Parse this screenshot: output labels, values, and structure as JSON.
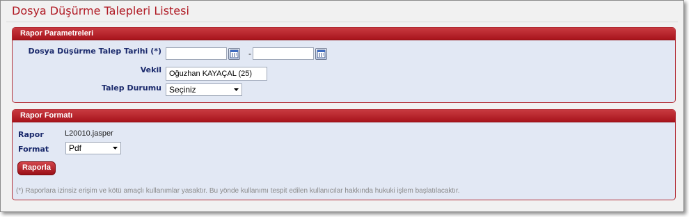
{
  "page": {
    "title": "Dosya Düşürme Talepleri Listesi"
  },
  "params_panel": {
    "header": "Rapor Parametreleri",
    "date_label": "Dosya Düşürme Talep Tarihi (*)",
    "date_from": "",
    "date_separator": "-",
    "date_to": "",
    "vekil_label": "Vekil",
    "vekil_value": "Oğuzhan KAYAÇAL (25)",
    "status_label": "Talep Durumu",
    "status_value": "Seçiniz"
  },
  "format_panel": {
    "header": "Rapor Formatı",
    "rapor_label": "Rapor",
    "rapor_value": "L20010.jasper",
    "format_label": "Format",
    "format_value": "Pdf",
    "submit_label": "Raporla",
    "footnote": "(*) Raporlara izinsiz erişim ve kötü amaçlı kullanımlar yasaktır. Bu yönde kullanımı tespit edilen kullanıcılar hakkında hukuki işlem başlatılacaktır."
  },
  "icons": {
    "calendar": "calendar-icon",
    "dropdown": "chevron-down-icon"
  },
  "colors": {
    "accent": "#b01a24",
    "panel_bg": "#e2e8f4",
    "label": "#1b2a6c"
  }
}
